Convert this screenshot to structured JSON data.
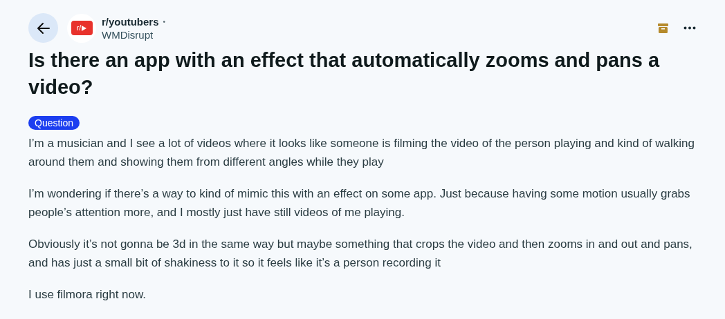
{
  "header": {
    "logo_text": "r/",
    "subreddit": "r/youtubers",
    "separator": "•",
    "author": "WMDisrupt"
  },
  "title": "Is there an app with an effect that automatically zooms and pans a video?",
  "flair": "Question",
  "paragraphs": [
    "I’m a musician and I see a lot of videos where it looks like someone is filming the video of the person playing and kind of walking around them and showing them from different angles while they play",
    "I’m wondering if there’s a way to kind of mimic this with an effect on some app. Just because having some motion usually grabs people’s attention more, and I mostly just have still videos of me playing.",
    "Obviously it’s not gonna be 3d in the same way but maybe something that crops the video and then zooms in and out and pans, and has just a small bit of shakiness to it so it feels like it’s a person recording it",
    "I use filmora right now."
  ]
}
